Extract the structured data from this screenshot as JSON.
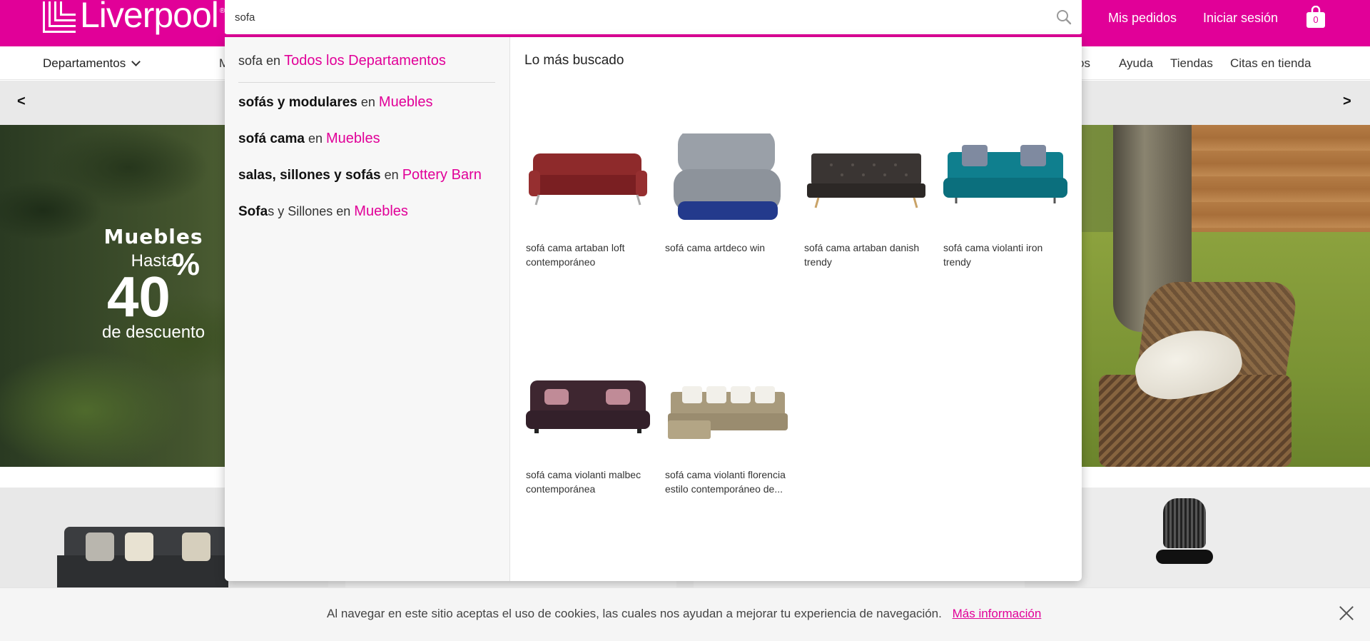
{
  "header": {
    "logo_text": "Liverpool",
    "logo_reg": "®",
    "search_value": "sofa",
    "orders_label": "Mis pedidos",
    "login_label": "Iniciar sesión",
    "cart_count": "0",
    "brand_color": "#e10098"
  },
  "nav": {
    "departments_label": "Departamentos",
    "partial_item": "M",
    "partial_item_right": "os",
    "help_label": "Ayuda",
    "stores_label": "Tiendas",
    "appointments_label": "Citas en tienda"
  },
  "carousel": {
    "prev": "<",
    "next": ">"
  },
  "hero": {
    "title": "Muebles",
    "hasta": "Hasta",
    "percent": "40",
    "percent_sign": "%",
    "desc": "de descuento"
  },
  "search_dropdown": {
    "all": {
      "term": "sofa",
      "connector": "en",
      "dept": "Todos los Departamentos"
    },
    "suggestions": [
      {
        "bold": "sofás y modulares",
        "rest": "",
        "connector": "en",
        "dept": "Muebles"
      },
      {
        "bold": "sofá cama",
        "rest": "",
        "connector": "en",
        "dept": "Muebles"
      },
      {
        "bold": "salas, sillones y sofás",
        "rest": "",
        "connector": "en",
        "dept": "Pottery Barn"
      },
      {
        "bold": "Sofa",
        "rest": "s y Sillones",
        "connector": "en",
        "dept": "Muebles"
      }
    ],
    "top_title": "Lo más buscado",
    "products": [
      {
        "name": "sofá cama artaban loft contemporáneo",
        "icon": "red-sofa-image"
      },
      {
        "name": "sofá cama artdeco win",
        "icon": "gray-chair-image"
      },
      {
        "name": "sofá cama artaban danish trendy",
        "icon": "dark-sofa-image"
      },
      {
        "name": "sofá cama violanti iron trendy",
        "icon": "teal-sofa-image"
      },
      {
        "name": "sofá cama violanti malbec contemporánea",
        "icon": "plum-sofa-image"
      },
      {
        "name": "sofá cama violanti florencia estilo contemporáneo de...",
        "icon": "sectional-sofa-image"
      }
    ]
  },
  "cookie": {
    "text": "Al navegar en este sitio aceptas el uso de cookies, las cuales nos ayudan a mejorar tu experiencia de navegación.",
    "link": "Más información"
  }
}
